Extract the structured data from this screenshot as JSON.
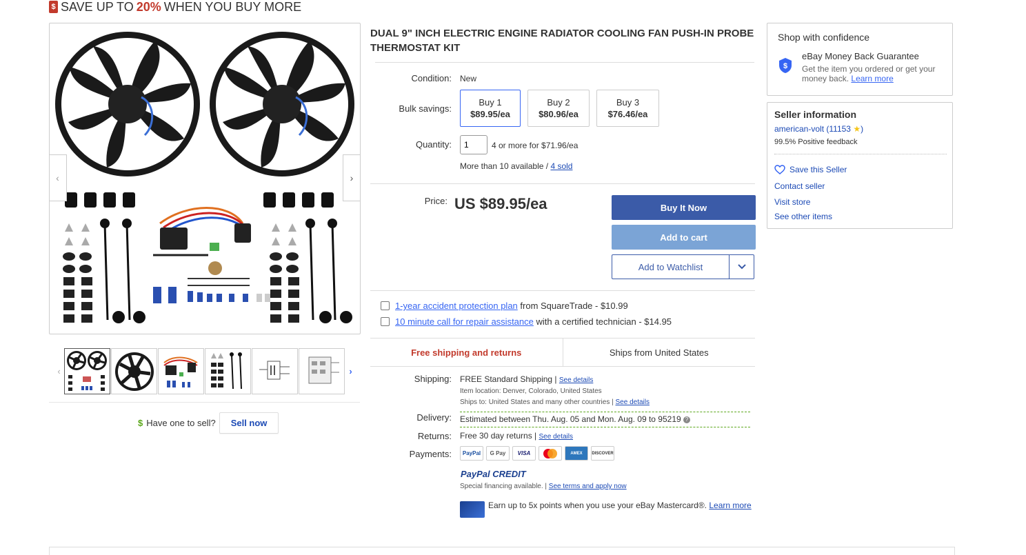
{
  "promo": {
    "prefix": "SAVE UP TO",
    "percent": "20%",
    "suffix": "WHEN YOU BUY MORE",
    "icon": "price-tag-icon"
  },
  "gallery": {
    "prev_icon": "chevron-left-icon",
    "next_icon": "chevron-right-icon",
    "thumbnail_count": 6
  },
  "sell": {
    "prompt": "Have one to sell?",
    "button": "Sell now"
  },
  "product": {
    "title": "DUAL 9\" INCH ELECTRIC ENGINE RADIATOR COOLING FAN PUSH-IN PROBE THERMOSTAT KIT",
    "condition_label": "Condition:",
    "condition_value": "New",
    "bulk_label": "Bulk savings:",
    "bulk_options": [
      {
        "qty": "Buy 1",
        "price": "$89.95/ea",
        "selected": true
      },
      {
        "qty": "Buy 2",
        "price": "$80.96/ea",
        "selected": false
      },
      {
        "qty": "Buy 3",
        "price": "$76.46/ea",
        "selected": false
      }
    ],
    "quantity_label": "Quantity:",
    "quantity_value": "1",
    "quantity_deal": "4 or more for $71.96/ea",
    "availability": "More than 10 available /",
    "sold_link": "4 sold",
    "price_label": "Price:",
    "price": "US $89.95/ea"
  },
  "actions": {
    "buy_now": "Buy It Now",
    "add_to_cart": "Add to cart",
    "watchlist": "Add to Watchlist"
  },
  "addons": [
    {
      "link": "1-year accident protection plan",
      "text": " from SquareTrade - $10.99"
    },
    {
      "link": "10 minute call for repair assistance",
      "text": " with a certified technician - $14.95"
    }
  ],
  "shipping_tabs": {
    "free": "Free shipping and returns",
    "from": "Ships from United States"
  },
  "shipping": {
    "label": "Shipping:",
    "value": "FREE  Standard Shipping |",
    "details_link": "See details",
    "location": "Item location:  Denver, Colorado, United States",
    "ships_to": "Ships to:  United States and many other countries |",
    "ships_to_link": "See details"
  },
  "delivery": {
    "label": "Delivery:",
    "value": "Estimated between Thu. Aug. 05 and Mon. Aug. 09 to 95219"
  },
  "returns": {
    "label": "Returns:",
    "value": "Free 30 day returns |",
    "link": "See details"
  },
  "payments": {
    "label": "Payments:",
    "methods": [
      "PayPal",
      "G Pay",
      "VISA",
      "MC",
      "AMEX",
      "DISCOVER"
    ],
    "paypal_credit": "PayPal CREDIT",
    "financing": "Special financing available.  |",
    "financing_link": "See terms and apply now",
    "mastercard_text": "Earn up to 5x points when you use your eBay Mastercard®.",
    "mastercard_link": "Learn more"
  },
  "confidence": {
    "title": "Shop with confidence",
    "guarantee_title": "eBay Money Back Guarantee",
    "guarantee_text": "Get the item you ordered or get your money back.",
    "learn_more": "Learn more"
  },
  "seller": {
    "title": "Seller information",
    "name": "american-volt",
    "score": "(11153",
    "score_close": ")",
    "feedback": "99.5% Positive feedback",
    "save": "Save this Seller",
    "contact": "Contact seller",
    "visit": "Visit store",
    "other": "See other items"
  },
  "colors": {
    "accent_red": "#c23a2c",
    "buy_blue": "#3b5ba8",
    "cart_blue": "#7ba4d6",
    "link_blue": "#1c4ab5"
  }
}
